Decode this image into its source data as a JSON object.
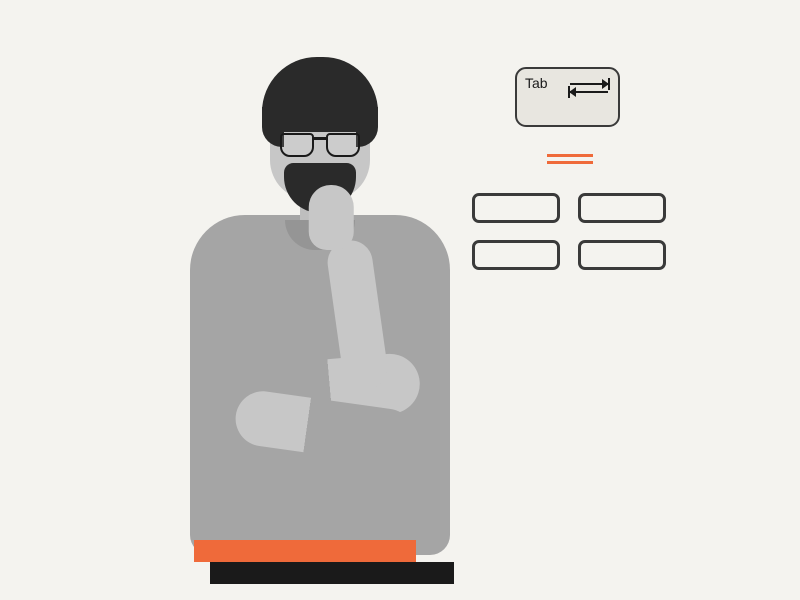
{
  "tab_key": {
    "label": "Tab"
  },
  "colors": {
    "accent": "#ef6a3a",
    "background": "#f4f3ef",
    "dark": "#1a1a1a"
  }
}
